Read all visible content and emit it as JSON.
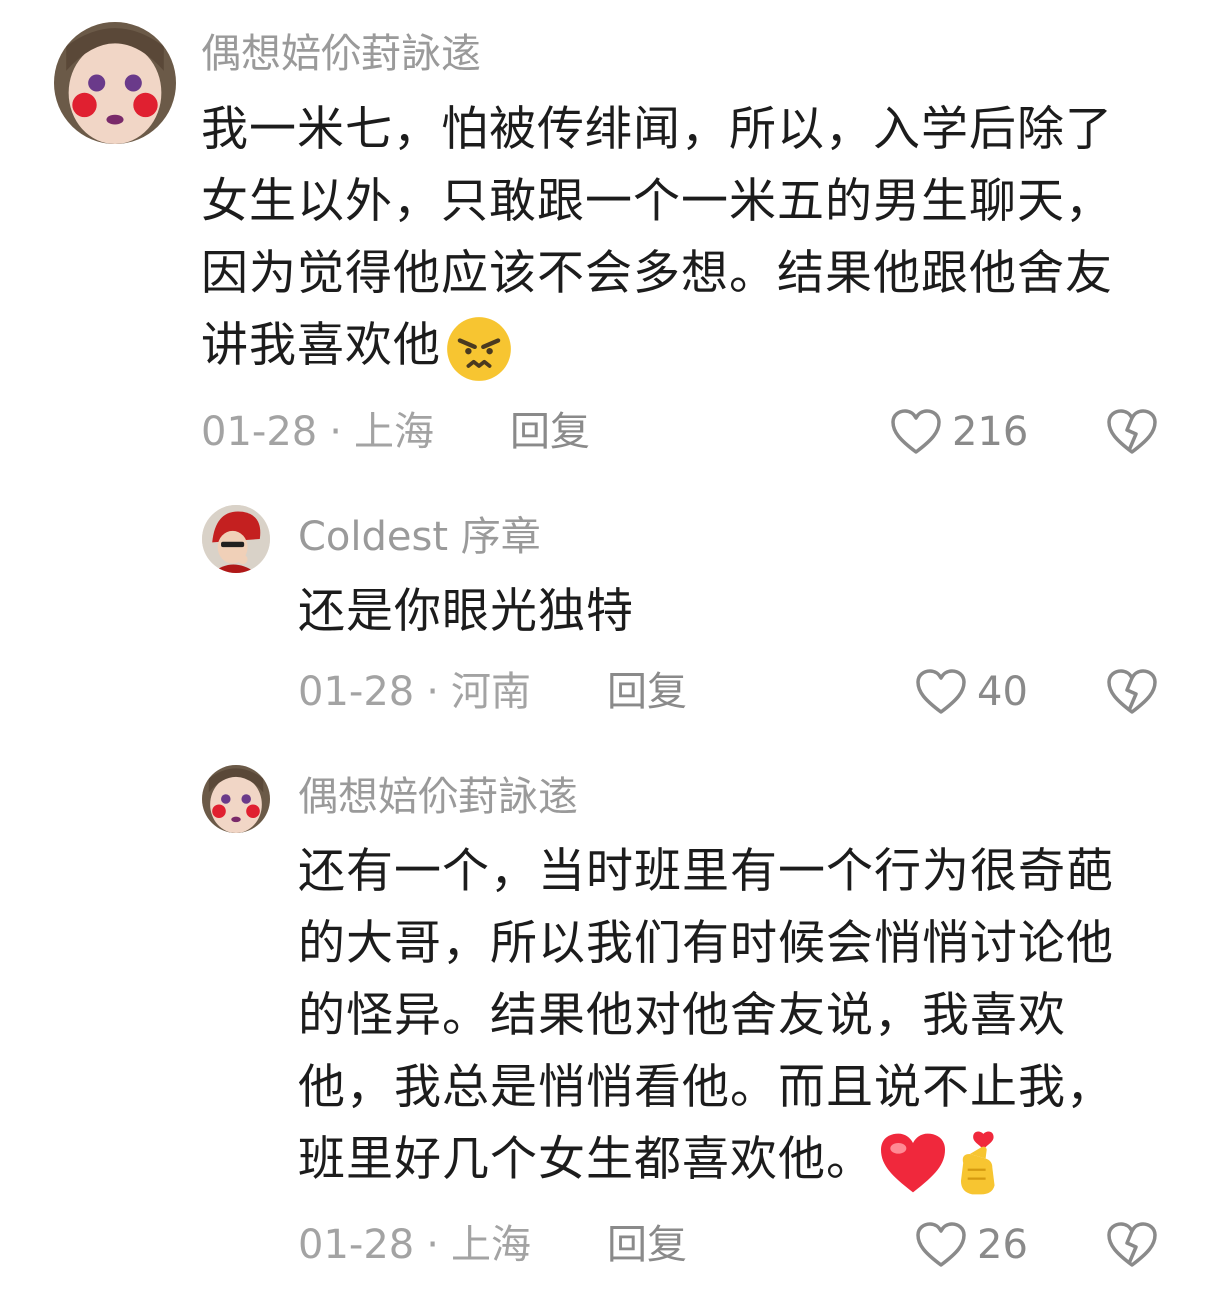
{
  "comments": [
    {
      "username": "偶想婄伱葑詠逺",
      "lines": [
        "我一米七，怕被传绯闻，所以，入学后除了",
        "女生以外，只敢跟一个一米五的男生聊天，",
        "因为觉得他应该不会多想。结果他跟他舍友",
        "讲我喜欢他"
      ],
      "date": "01-28",
      "location": "上海",
      "reply_label": "回复",
      "likes": "216",
      "emoji": "angry-face-emoji"
    },
    {
      "username": "Coldest 序章",
      "lines": [
        "还是你眼光独特"
      ],
      "date": "01-28",
      "location": "河南",
      "reply_label": "回复",
      "likes": "40"
    },
    {
      "username": "偶想婄伱葑詠逺",
      "lines": [
        "还有一个，当时班里有一个行为很奇葩",
        "的大哥，所以我们有时候会悄悄讨论他",
        "的怪异。结果他对他舍友说，我喜欢",
        "他，我总是悄悄看他。而且说不止我，",
        "班里好几个女生都喜欢他。"
      ],
      "date": "01-28",
      "location": "上海",
      "reply_label": "回复",
      "likes": "26",
      "emoji": [
        "red-heart-emoji",
        "finger-heart-emoji"
      ]
    }
  ],
  "separator": "·",
  "colors": {
    "text": "#1c1c1c",
    "muted": "#9a9a9a",
    "icon": "#8a8a8a",
    "heart_red": "#f0283c",
    "emoji_yellow": "#f7c531"
  }
}
